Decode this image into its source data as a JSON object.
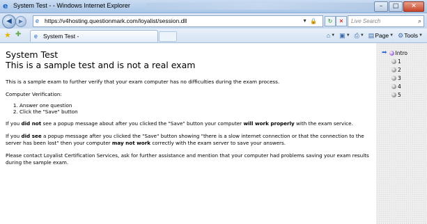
{
  "window": {
    "title": "System Test - - Windows Internet Explorer",
    "minimize": "–",
    "maximize": "□",
    "close": "✕"
  },
  "address_bar": {
    "url": "https://v4hosting.questionmark.com/loyalist/session.dll",
    "search_placeholder": "Live Search"
  },
  "tab_bar": {
    "tab_label": "System Test -",
    "page_label": "Page",
    "tools_label": "Tools"
  },
  "content": {
    "title_line1": "System Test",
    "title_line2": "This is a sample test and is not a real exam",
    "intro": "This is a sample exam to further verify that your exam computer has no difficulties during the exam process.",
    "verification_heading": "Computer Verification:",
    "steps": [
      "Answer one question",
      "Click the \"Save\" button"
    ],
    "para1": {
      "a": "If you ",
      "b": "did not",
      "c": " see a popup message about after you clicked the \"Save\" button your computer ",
      "d": "will work properly",
      "e": " with the exam service."
    },
    "para2": {
      "a": "If you ",
      "b": "did see",
      "c": " a popup message after you clicked the \"Save\" button showing \"there is a slow internet connection or that the connection to the server has been lost\" then your computer ",
      "d": "may not work",
      "e": " correctly with the exam server to save your answers."
    },
    "para3": "Please contact Loyalist Certification Services, ask for further assistance and mention that your computer had problems saving your exam results during the sample exam."
  },
  "side_nav": {
    "items": [
      "Intro",
      "1",
      "2",
      "3",
      "4",
      "5"
    ],
    "active": "Intro"
  },
  "icons": {
    "browser": "ie-logo-icon",
    "back": "back-arrow-icon",
    "forward": "forward-arrow-icon",
    "lock": "lock-icon",
    "refresh": "refresh-icon",
    "stop": "stop-icon",
    "search": "search-icon",
    "favorites": "favorites-star-icon",
    "home": "home-icon",
    "feeds": "feeds-icon",
    "print": "print-icon",
    "page": "page-icon",
    "tools": "tools-gear-icon"
  },
  "colors": {
    "chrome_blue": "#c6d8ef",
    "nav_active": "#a46bd9",
    "nav_arrow": "#3c6fd6"
  }
}
